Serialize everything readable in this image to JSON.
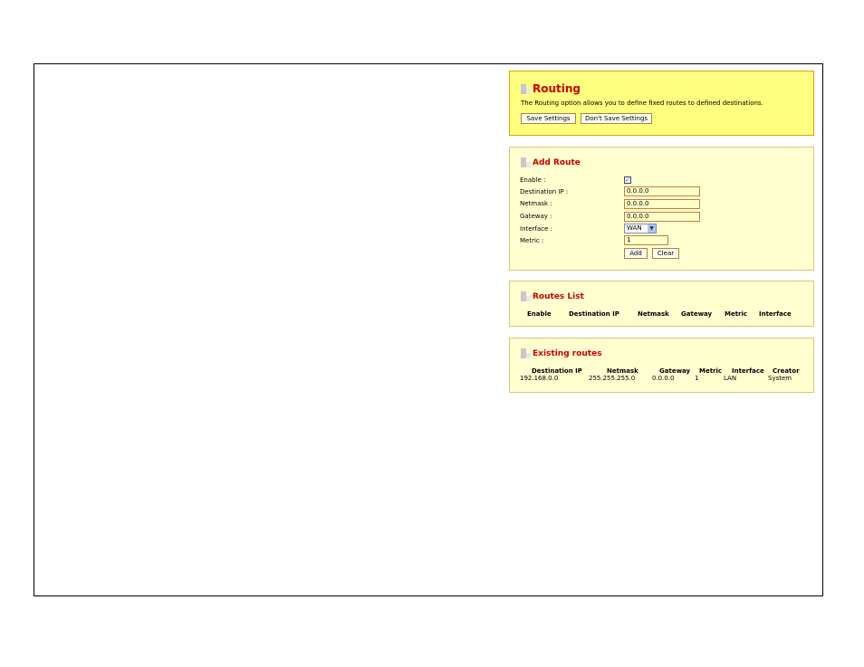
{
  "routing": {
    "title": "Routing",
    "description": "The Routing option allows you to define fixed routes to defined destinations.",
    "save_label": "Save Settings",
    "dont_save_label": "Don't Save Settings"
  },
  "add_route": {
    "title": "Add Route",
    "enable_label": "Enable :",
    "enable_checked": "✓",
    "destination_ip_label": "Destination IP :",
    "destination_ip_value": "0.0.0.0",
    "netmask_label": "Netmask :",
    "netmask_value": "0.0.0.0",
    "gateway_label": "Gateway :",
    "gateway_value": "0.0.0.0",
    "interface_label": "Interface :",
    "interface_value": "WAN",
    "metric_label": "Metric :",
    "metric_value": "1",
    "add_label": "Add",
    "clear_label": "Clear"
  },
  "routes_list": {
    "title": "Routes List",
    "columns": [
      "Enable",
      "Destination IP",
      "Netmask",
      "Gateway",
      "Metric",
      "Interface"
    ]
  },
  "existing_routes": {
    "title": "Existing routes",
    "columns": [
      "Destination IP",
      "Netmask",
      "Gateway",
      "Metric",
      "Interface",
      "Creator"
    ],
    "rows": [
      [
        "192.168.0.0",
        "255.255.255.0",
        "0.0.0.0",
        "1",
        "LAN",
        "System"
      ]
    ]
  },
  "icons": {
    "section": "section-bullet-icon",
    "dropdown": "chevron-down-icon"
  },
  "colors": {
    "title_red": "#cc0000",
    "panel_yellow": "#ffff80",
    "panel_light": "#ffffd0"
  }
}
